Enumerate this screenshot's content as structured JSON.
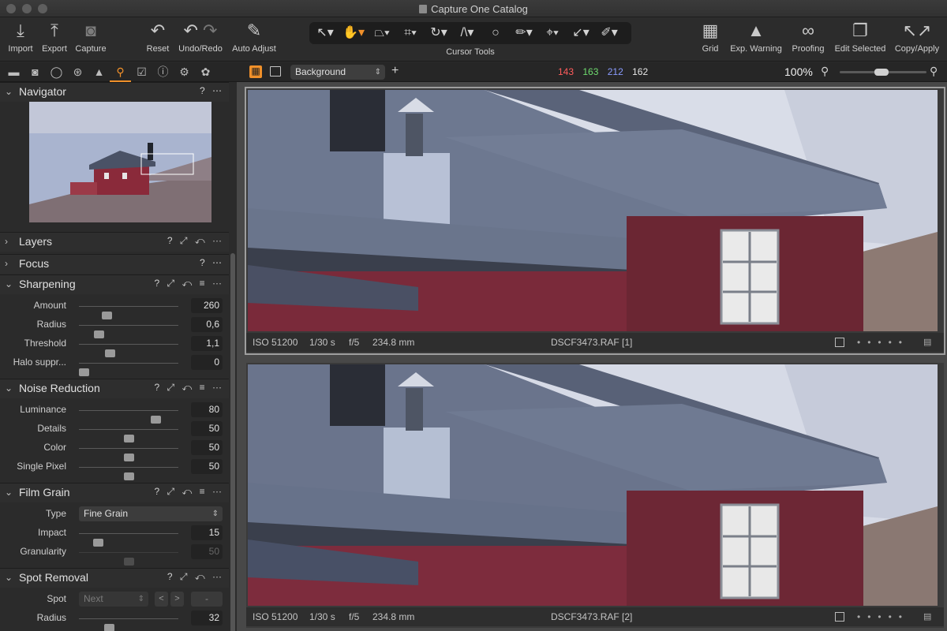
{
  "window": {
    "title": "Capture One Catalog"
  },
  "toolbar": {
    "import": "Import",
    "export": "Export",
    "capture": "Capture",
    "reset": "Reset",
    "undo_redo": "Undo/Redo",
    "auto_adjust": "Auto Adjust",
    "cursor_tools": "Cursor Tools",
    "grid": "Grid",
    "exp_warning": "Exp. Warning",
    "proofing": "Proofing",
    "edit_selected": "Edit Selected",
    "copy_apply": "Copy/Apply"
  },
  "viewer_bar": {
    "layer": "Background",
    "rgb": {
      "r": "143",
      "g": "163",
      "b": "212",
      "l": "162"
    },
    "zoom": "100%"
  },
  "colors": {
    "accent": "#f0902a",
    "red": "#ff5c5c",
    "green": "#6fdc6f",
    "blue": "#8a9cff"
  },
  "panels": {
    "navigator": {
      "title": "Navigator"
    },
    "layers": {
      "title": "Layers"
    },
    "focus": {
      "title": "Focus"
    },
    "sharpening": {
      "title": "Sharpening",
      "amount": {
        "label": "Amount",
        "value": "260",
        "pos": 0.28
      },
      "radius": {
        "label": "Radius",
        "value": "0,6",
        "pos": 0.2
      },
      "threshold": {
        "label": "Threshold",
        "value": "1,1",
        "pos": 0.31
      },
      "halo": {
        "label": "Halo suppr...",
        "value": "0",
        "pos": 0.05
      }
    },
    "noise_reduction": {
      "title": "Noise Reduction",
      "luminance": {
        "label": "Luminance",
        "value": "80",
        "pos": 0.77
      },
      "details": {
        "label": "Details",
        "value": "50",
        "pos": 0.5
      },
      "color": {
        "label": "Color",
        "value": "50",
        "pos": 0.5
      },
      "single_pixel": {
        "label": "Single Pixel",
        "value": "50",
        "pos": 0.5
      }
    },
    "film_grain": {
      "title": "Film Grain",
      "type_label": "Type",
      "type_value": "Fine Grain",
      "impact": {
        "label": "Impact",
        "value": "15",
        "pos": 0.19
      },
      "granularity": {
        "label": "Granularity",
        "value": "50",
        "pos": 0.5
      }
    },
    "spot_removal": {
      "title": "Spot Removal",
      "spot_label": "Spot",
      "spot_value": "Next",
      "minus": "-",
      "radius": {
        "label": "Radius",
        "value": "32",
        "pos": 0.3
      }
    }
  },
  "viewer": {
    "images": [
      {
        "iso": "ISO 51200",
        "shutter": "1/30 s",
        "aperture": "f/5",
        "focal": "234.8 mm",
        "filename": "DSCF3473.RAF [1]"
      },
      {
        "iso": "ISO 51200",
        "shutter": "1/30 s",
        "aperture": "f/5",
        "focal": "234.8 mm",
        "filename": "DSCF3473.RAF [2]"
      }
    ]
  }
}
